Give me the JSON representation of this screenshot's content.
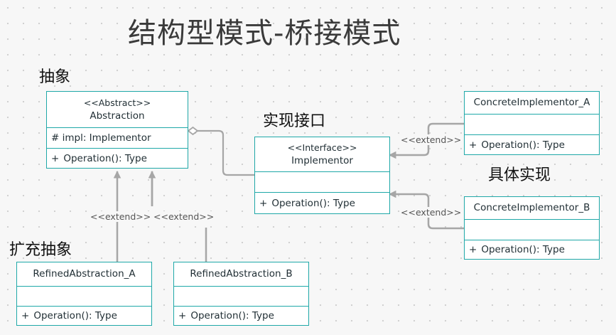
{
  "title": "结构型模式-桥接模式",
  "labels": {
    "abstraction": "抽象",
    "interface": "实现接口",
    "concrete": "具体实现",
    "refined": "扩充抽象"
  },
  "classes": {
    "abstraction": {
      "stereotype": "<<Abstract>>",
      "name": "Abstraction",
      "attribute": "# impl: Implementor",
      "operation": "Operation(): Type"
    },
    "implementor": {
      "stereotype": "<<Interface>>",
      "name": "Implementor",
      "attribute": "",
      "operation": "Operation(): Type"
    },
    "concrete_a": {
      "name": "ConcreteImplementor_A",
      "attribute": "",
      "operation": "Operation(): Type"
    },
    "concrete_b": {
      "name": "ConcreteImplementor_B",
      "attribute": "",
      "operation": "Operation(): Type"
    },
    "refined_a": {
      "name": "RefinedAbstraction_A",
      "attribute": "",
      "operation": "Operation(): Type"
    },
    "refined_b": {
      "name": "RefinedAbstraction_B",
      "attribute": "",
      "operation": "Operation(): Type"
    }
  },
  "operation_prefix": "+",
  "edges": {
    "extend_label": "<<extend>>"
  },
  "colors": {
    "class_border": "#1fa8a8",
    "connector": "#a6a6a6",
    "background": "#f7f7f7"
  }
}
